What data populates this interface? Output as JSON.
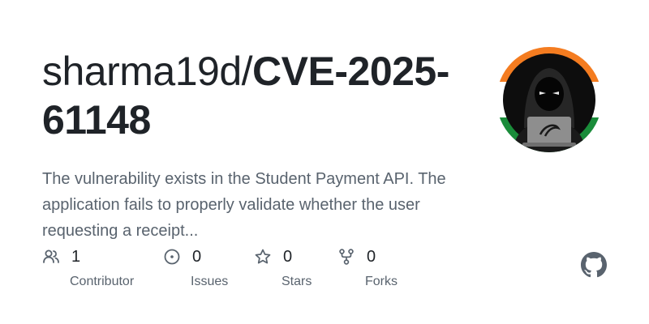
{
  "repo": {
    "owner": "sharma19d/",
    "name": "CVE-2025-61148"
  },
  "description": "The vulnerability exists in the Student Payment API. The application fails to properly validate whether the user requesting a receipt...",
  "stats": [
    {
      "icon": "people-icon",
      "count": "1",
      "label": "Contributor"
    },
    {
      "icon": "issue-icon",
      "count": "0",
      "label": "Issues"
    },
    {
      "icon": "star-icon",
      "count": "0",
      "label": "Stars"
    },
    {
      "icon": "fork-icon",
      "count": "0",
      "label": "Forks"
    }
  ],
  "colors": {
    "text": "#1f2328",
    "muted": "#59636e",
    "flag_saffron": "#f47c20",
    "flag_white": "#ffffff",
    "flag_green": "#1a8c3a",
    "avatar_bg": "#0d0d0d"
  }
}
